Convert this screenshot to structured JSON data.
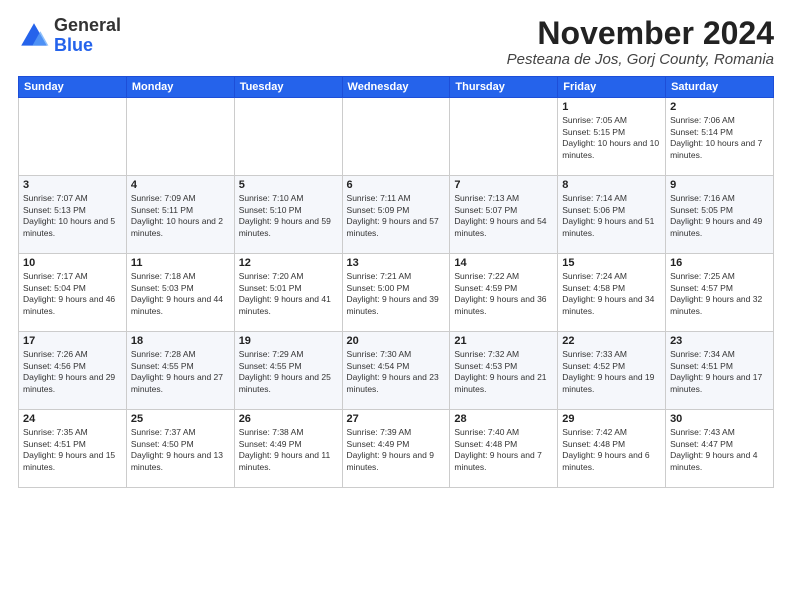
{
  "logo": {
    "general": "General",
    "blue": "Blue"
  },
  "title": {
    "month": "November 2024",
    "location": "Pesteana de Jos, Gorj County, Romania"
  },
  "headers": [
    "Sunday",
    "Monday",
    "Tuesday",
    "Wednesday",
    "Thursday",
    "Friday",
    "Saturday"
  ],
  "weeks": [
    [
      {
        "day": "",
        "info": ""
      },
      {
        "day": "",
        "info": ""
      },
      {
        "day": "",
        "info": ""
      },
      {
        "day": "",
        "info": ""
      },
      {
        "day": "",
        "info": ""
      },
      {
        "day": "1",
        "info": "Sunrise: 7:05 AM\nSunset: 5:15 PM\nDaylight: 10 hours and 10 minutes."
      },
      {
        "day": "2",
        "info": "Sunrise: 7:06 AM\nSunset: 5:14 PM\nDaylight: 10 hours and 7 minutes."
      }
    ],
    [
      {
        "day": "3",
        "info": "Sunrise: 7:07 AM\nSunset: 5:13 PM\nDaylight: 10 hours and 5 minutes."
      },
      {
        "day": "4",
        "info": "Sunrise: 7:09 AM\nSunset: 5:11 PM\nDaylight: 10 hours and 2 minutes."
      },
      {
        "day": "5",
        "info": "Sunrise: 7:10 AM\nSunset: 5:10 PM\nDaylight: 9 hours and 59 minutes."
      },
      {
        "day": "6",
        "info": "Sunrise: 7:11 AM\nSunset: 5:09 PM\nDaylight: 9 hours and 57 minutes."
      },
      {
        "day": "7",
        "info": "Sunrise: 7:13 AM\nSunset: 5:07 PM\nDaylight: 9 hours and 54 minutes."
      },
      {
        "day": "8",
        "info": "Sunrise: 7:14 AM\nSunset: 5:06 PM\nDaylight: 9 hours and 51 minutes."
      },
      {
        "day": "9",
        "info": "Sunrise: 7:16 AM\nSunset: 5:05 PM\nDaylight: 9 hours and 49 minutes."
      }
    ],
    [
      {
        "day": "10",
        "info": "Sunrise: 7:17 AM\nSunset: 5:04 PM\nDaylight: 9 hours and 46 minutes."
      },
      {
        "day": "11",
        "info": "Sunrise: 7:18 AM\nSunset: 5:03 PM\nDaylight: 9 hours and 44 minutes."
      },
      {
        "day": "12",
        "info": "Sunrise: 7:20 AM\nSunset: 5:01 PM\nDaylight: 9 hours and 41 minutes."
      },
      {
        "day": "13",
        "info": "Sunrise: 7:21 AM\nSunset: 5:00 PM\nDaylight: 9 hours and 39 minutes."
      },
      {
        "day": "14",
        "info": "Sunrise: 7:22 AM\nSunset: 4:59 PM\nDaylight: 9 hours and 36 minutes."
      },
      {
        "day": "15",
        "info": "Sunrise: 7:24 AM\nSunset: 4:58 PM\nDaylight: 9 hours and 34 minutes."
      },
      {
        "day": "16",
        "info": "Sunrise: 7:25 AM\nSunset: 4:57 PM\nDaylight: 9 hours and 32 minutes."
      }
    ],
    [
      {
        "day": "17",
        "info": "Sunrise: 7:26 AM\nSunset: 4:56 PM\nDaylight: 9 hours and 29 minutes."
      },
      {
        "day": "18",
        "info": "Sunrise: 7:28 AM\nSunset: 4:55 PM\nDaylight: 9 hours and 27 minutes."
      },
      {
        "day": "19",
        "info": "Sunrise: 7:29 AM\nSunset: 4:55 PM\nDaylight: 9 hours and 25 minutes."
      },
      {
        "day": "20",
        "info": "Sunrise: 7:30 AM\nSunset: 4:54 PM\nDaylight: 9 hours and 23 minutes."
      },
      {
        "day": "21",
        "info": "Sunrise: 7:32 AM\nSunset: 4:53 PM\nDaylight: 9 hours and 21 minutes."
      },
      {
        "day": "22",
        "info": "Sunrise: 7:33 AM\nSunset: 4:52 PM\nDaylight: 9 hours and 19 minutes."
      },
      {
        "day": "23",
        "info": "Sunrise: 7:34 AM\nSunset: 4:51 PM\nDaylight: 9 hours and 17 minutes."
      }
    ],
    [
      {
        "day": "24",
        "info": "Sunrise: 7:35 AM\nSunset: 4:51 PM\nDaylight: 9 hours and 15 minutes."
      },
      {
        "day": "25",
        "info": "Sunrise: 7:37 AM\nSunset: 4:50 PM\nDaylight: 9 hours and 13 minutes."
      },
      {
        "day": "26",
        "info": "Sunrise: 7:38 AM\nSunset: 4:49 PM\nDaylight: 9 hours and 11 minutes."
      },
      {
        "day": "27",
        "info": "Sunrise: 7:39 AM\nSunset: 4:49 PM\nDaylight: 9 hours and 9 minutes."
      },
      {
        "day": "28",
        "info": "Sunrise: 7:40 AM\nSunset: 4:48 PM\nDaylight: 9 hours and 7 minutes."
      },
      {
        "day": "29",
        "info": "Sunrise: 7:42 AM\nSunset: 4:48 PM\nDaylight: 9 hours and 6 minutes."
      },
      {
        "day": "30",
        "info": "Sunrise: 7:43 AM\nSunset: 4:47 PM\nDaylight: 9 hours and 4 minutes."
      }
    ]
  ]
}
